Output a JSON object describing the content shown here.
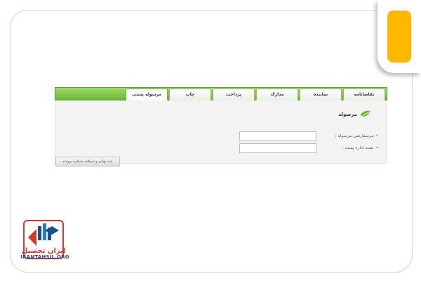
{
  "tabs": [
    {
      "label": "تقاضانامه"
    },
    {
      "label": "نماینده"
    },
    {
      "label": "مدارک"
    },
    {
      "label": "پرداخت"
    },
    {
      "label": "چاپ"
    },
    {
      "label": "مرسوله پستی",
      "active": true
    }
  ],
  "section": {
    "title": "مرسوله"
  },
  "form": {
    "fields": [
      {
        "label": "مرسفارشی مرسوله :",
        "required_mark": "*",
        "value": ""
      },
      {
        "label": "بسته اداره پست :",
        "required_mark": "*",
        "value": ""
      }
    ],
    "submit_label": "ثبت نهایی و دریافت شماره پرونده"
  },
  "logo": {
    "name": "ایران تحصیل",
    "url_text": "IRANTAHSIL.ORG"
  },
  "colors": {
    "tab_green": "#6cb834",
    "accent": "#ffb700",
    "required": "#ee4444"
  }
}
